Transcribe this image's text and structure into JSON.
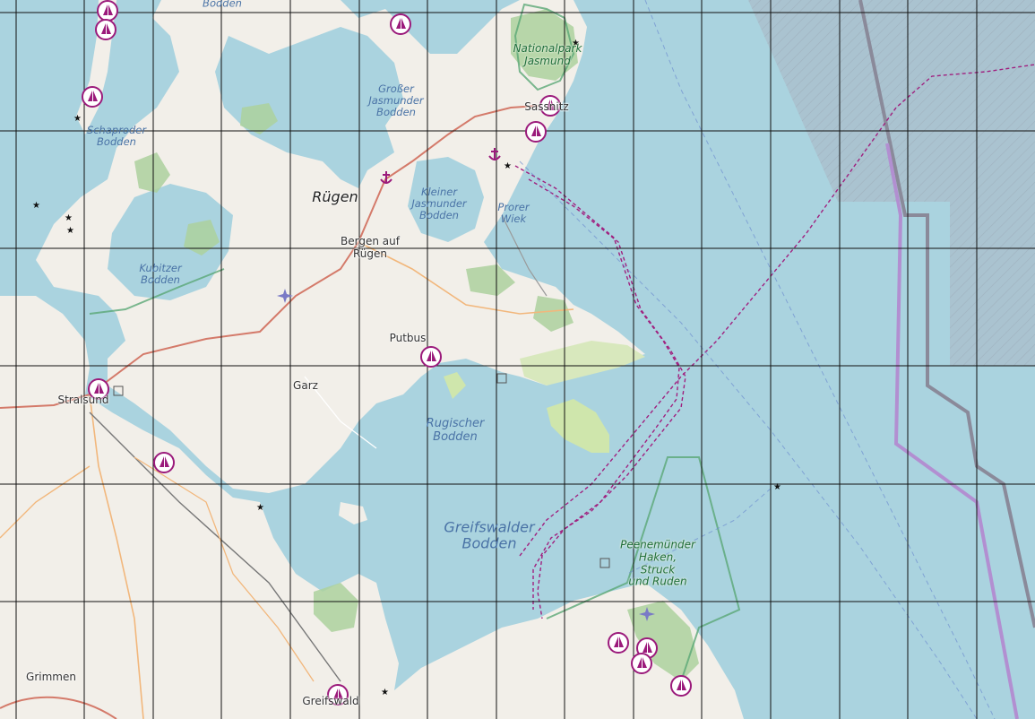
{
  "map": {
    "colors": {
      "water": "#aad3df",
      "land": "#f2efe9",
      "green": "#cfe6ac",
      "forest": "#add19e",
      "park_border": "#5aa876",
      "route": "#a0207f",
      "marina": "#9b1a7b",
      "boundary": "#8f8b9e",
      "boundary_purple": "#b28fd1",
      "grid": "#111111"
    },
    "labels": {
      "ruegen": "Rügen",
      "bergen": "Bergen auf\nRügen",
      "putbus": "Putbus",
      "garz": "Garz",
      "stralsund": "Stralsund",
      "grimmen": "Grimmen",
      "greifswald": "Greifswald",
      "sassnitz": "Sassnitz",
      "nationalpark": "Nationalpark\nJasmund",
      "peenemuende": "Peenemünder\nHaken,\nStruck\nund Ruden",
      "gross_jasmunder": "Großer\nJasmunder\nBodden",
      "kleiner_jasmunder": "Kleiner\nJasmunder\nBodden",
      "prorer": "Prorer\nWiek",
      "schaproder": "Schaproder\nBodden",
      "kubitzer": "Kubitzer\nBodden",
      "rugischer": "Rugischer\nBodden",
      "greifswalder": "Greifswalder\nBodden",
      "top_bodden": "Bodden"
    },
    "icons": {
      "marina": "sailboat-marina-icon",
      "anchor": "anchorage-icon",
      "airport": "airport-icon",
      "beacon": "beacon-light-icon"
    }
  }
}
